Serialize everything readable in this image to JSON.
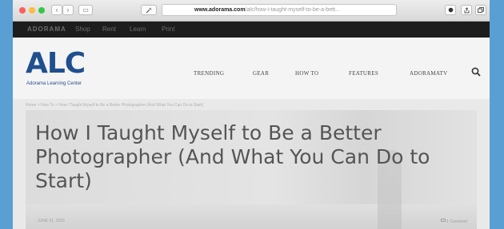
{
  "browser": {
    "url_domain": "www.adorama.com",
    "url_path": "/alc/how-i-taught-myself-to-be-a-bett...",
    "back_glyph": "‹",
    "forward_glyph": "›",
    "sidebar_glyph": "▭",
    "lock_glyph": "🔒",
    "reload_glyph": "↻"
  },
  "site_top": {
    "brand": "ADORAMA",
    "links": [
      "Shop",
      "Rent",
      "Learn",
      "Print"
    ]
  },
  "header": {
    "logo": "ALC",
    "logo_sub": "Adorama Learning Center",
    "nav": [
      "TRENDING",
      "GEAR",
      "HOW TO",
      "FEATURES",
      "ADORAMATV"
    ]
  },
  "breadcrumb": "Home > How To > How I Taught Myself to Be a Better Photographer (And What You Can Do to Start)",
  "article": {
    "title": "How I Taught Myself to Be a Better Photographer (And What You Can Do to Start)",
    "meta": "JUNE 01, 2015",
    "comments": "1 Comment"
  },
  "colors": {
    "page_bg": "#5a9fd3",
    "logo": "#1f4f8f",
    "site_top_bg": "#1d1d1d"
  }
}
